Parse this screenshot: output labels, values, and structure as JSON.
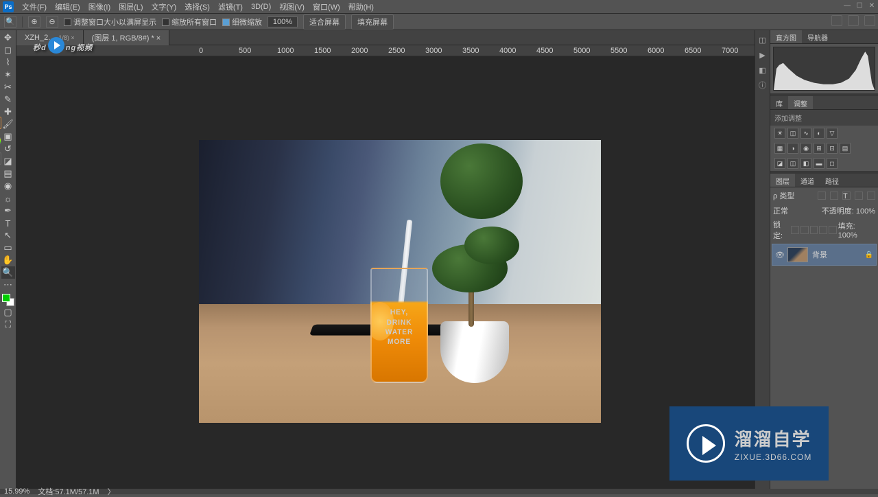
{
  "menubar": {
    "items": [
      "文件(F)",
      "编辑(E)",
      "图像(I)",
      "图层(L)",
      "文字(Y)",
      "选择(S)",
      "滤镜(T)",
      "3D(D)",
      "视图(V)",
      "窗口(W)",
      "帮助(H)"
    ]
  },
  "optbar": {
    "chk1": "调整窗口大小以满屏显示",
    "chk2": "缩放所有窗口",
    "chk3": "细微缩放",
    "zoom": "100%",
    "btn1": "适合屏幕",
    "btn2": "填充屏幕"
  },
  "tab": {
    "t1": "XZH_2...",
    "t1suffix": "1/8) ×",
    "t2": "(图层 1, RGB/8#) * ×"
  },
  "ruler": [
    "0",
    "500",
    "1000",
    "1500",
    "2000",
    "2500",
    "3000",
    "3500",
    "4000",
    "4500",
    "5000",
    "5500",
    "6000",
    "6500",
    "7000"
  ],
  "glass_text": {
    "l1": "HEY,",
    "l2": "DRINK",
    "l3": "WATER",
    "l4": "MORE"
  },
  "wm_left": {
    "a": "秒d",
    "b": "ng视频"
  },
  "wm_right": {
    "title": "溜溜自学",
    "sub": "ZIXUE.3D66.COM"
  },
  "panels": {
    "histo_tab1": "直方图",
    "histo_tab2": "导航器",
    "adj_tab1": "库",
    "adj_tab2": "调整",
    "adj_label": "添加调整",
    "lyr_tab1": "图层",
    "lyr_tab2": "通道",
    "lyr_tab3": "路径",
    "lyr_kind": "ρ 类型",
    "blend": "正常",
    "opacity_lbl": "不透明度:",
    "opacity": "100%",
    "lock_lbl": "锁定:",
    "fill_lbl": "填充:",
    "fill": "100%",
    "layer_name": "背景"
  },
  "status": {
    "zoom": "15.99%",
    "doc": "文档:57.1M/57.1M"
  }
}
